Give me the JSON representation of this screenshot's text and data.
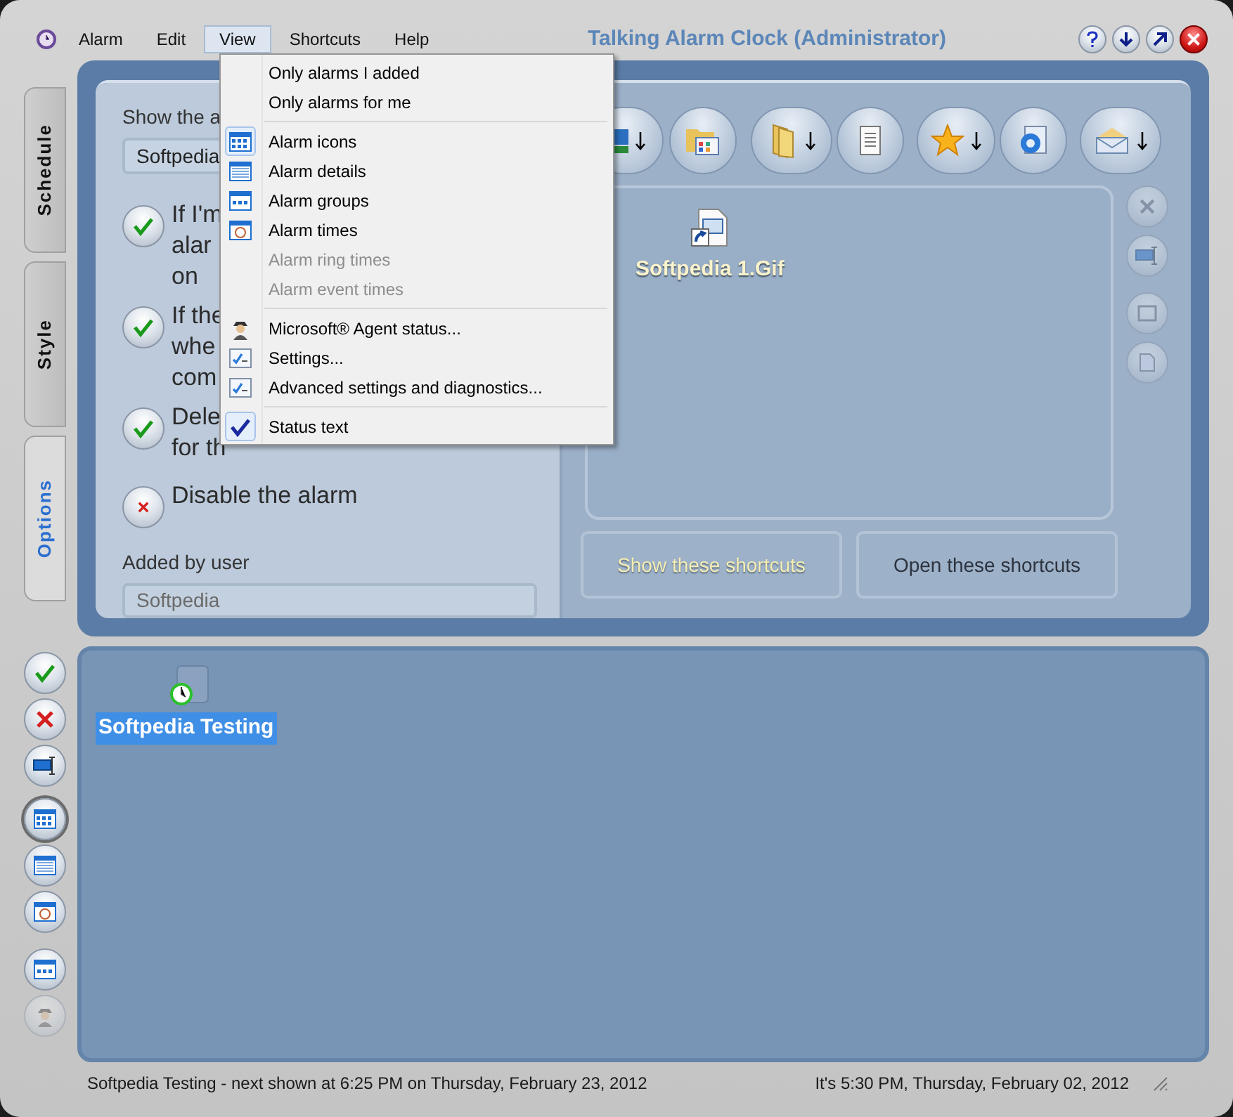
{
  "window": {
    "title": "Talking Alarm Clock (Administrator)"
  },
  "menu_bar": [
    {
      "label": "Alarm",
      "selected": false
    },
    {
      "label": "Edit",
      "selected": false
    },
    {
      "label": "View",
      "selected": true
    },
    {
      "label": "Shortcuts",
      "selected": false
    },
    {
      "label": "Help",
      "selected": false
    }
  ],
  "view_menu": [
    {
      "kind": "item",
      "label": "Only alarms I added",
      "checked": false,
      "disabled": false
    },
    {
      "kind": "item",
      "label": "Only alarms for me",
      "checked": false,
      "disabled": false
    },
    {
      "kind": "separator"
    },
    {
      "kind": "item",
      "label": "Alarm icons",
      "checked": true,
      "disabled": false
    },
    {
      "kind": "item",
      "label": "Alarm details",
      "checked": false,
      "disabled": false
    },
    {
      "kind": "item",
      "label": "Alarm groups",
      "checked": false,
      "disabled": false
    },
    {
      "kind": "item",
      "label": "Alarm times",
      "checked": false,
      "disabled": false
    },
    {
      "kind": "item",
      "label": "Alarm ring times",
      "checked": false,
      "disabled": true
    },
    {
      "kind": "item",
      "label": "Alarm event times",
      "checked": false,
      "disabled": true
    },
    {
      "kind": "separator"
    },
    {
      "kind": "item",
      "label": "Microsoft® Agent status...",
      "checked": false,
      "disabled": false
    },
    {
      "kind": "item",
      "label": "Settings...",
      "checked": false,
      "disabled": false
    },
    {
      "kind": "item",
      "label": "Advanced settings and diagnostics...",
      "checked": false,
      "disabled": false
    },
    {
      "kind": "separator"
    },
    {
      "kind": "item",
      "label": "Status text",
      "checked": true,
      "disabled": false
    }
  ],
  "side_tabs": [
    {
      "label": "Schedule",
      "selected": false
    },
    {
      "label": "Style",
      "selected": false
    },
    {
      "label": "Options",
      "selected": true
    }
  ],
  "options": {
    "show_label": "Show the a",
    "show_select": "Softpedia",
    "checks": [
      {
        "lines": [
          "If I'm",
          "alar",
          "on"
        ],
        "kind": "tick"
      },
      {
        "lines": [
          "If the",
          "whe",
          "com"
        ],
        "kind": "tick"
      },
      {
        "lines": [
          "Dele",
          "for th"
        ],
        "kind": "tick"
      },
      {
        "lines": [
          "Disable the alarm"
        ],
        "kind": "cross"
      }
    ],
    "added_by_label": "Added by user",
    "added_by_value": "Softpedia"
  },
  "shortcut_toolbar": [
    {
      "has_dropdown": true
    },
    {
      "has_dropdown": false
    },
    {
      "has_dropdown": true
    },
    {
      "has_dropdown": false
    },
    {
      "has_dropdown": true
    },
    {
      "has_dropdown": false
    },
    {
      "has_dropdown": true
    }
  ],
  "shortcuts": [
    {
      "label": "Softpedia 1.Gif"
    }
  ],
  "shortcut_side_buttons_disabled": true,
  "shortcut_buttons": [
    {
      "label": "Show these shortcuts",
      "highlighted": true
    },
    {
      "label": "Open these shortcuts",
      "highlighted": false
    }
  ],
  "view_buttons": [
    {
      "selected": true
    },
    {
      "selected": false
    },
    {
      "selected": false
    },
    {
      "selected": false
    }
  ],
  "agent_button": {
    "disabled": true
  },
  "alarms": [
    {
      "label": "Softpedia Testing",
      "selected": true
    }
  ],
  "status_bar": {
    "left": "Softpedia Testing - next shown at 6:25 PM on Thursday, February 23, 2012",
    "right": "It's 5:30 PM, Thursday, February 02, 2012"
  }
}
